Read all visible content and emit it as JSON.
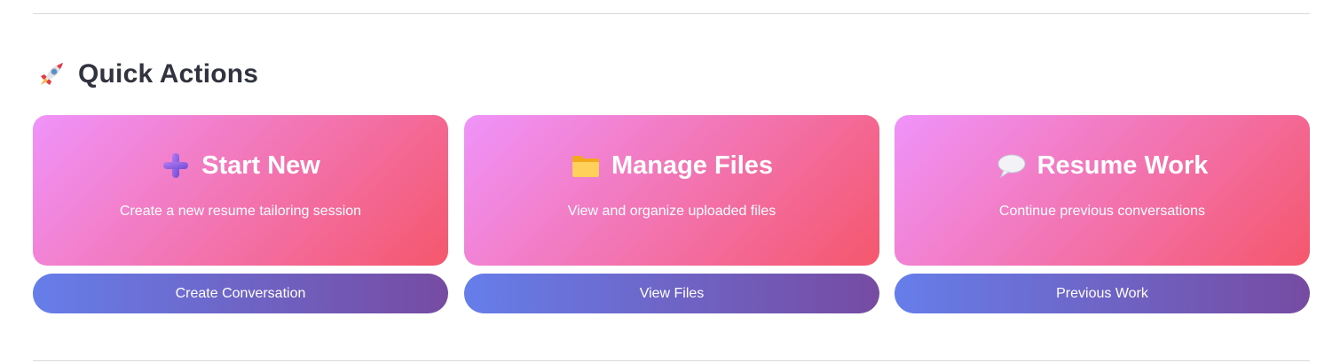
{
  "section": {
    "title": "Quick Actions",
    "icon": "rocket-icon"
  },
  "cards": [
    {
      "title": "Start New",
      "description": "Create a new resume tailoring session",
      "icon": "plus-icon",
      "button_label": "Create Conversation"
    },
    {
      "title": "Manage Files",
      "description": "View and organize uploaded files",
      "icon": "folder-icon",
      "button_label": "View Files"
    },
    {
      "title": "Resume Work",
      "description": "Continue previous conversations",
      "icon": "speech-bubble-icon",
      "button_label": "Previous Work"
    }
  ],
  "colors": {
    "card_gradient_start": "#f093fb",
    "card_gradient_end": "#f5576c",
    "button_gradient_start": "#667eea",
    "button_gradient_end": "#764ba2",
    "heading": "#31333f"
  }
}
